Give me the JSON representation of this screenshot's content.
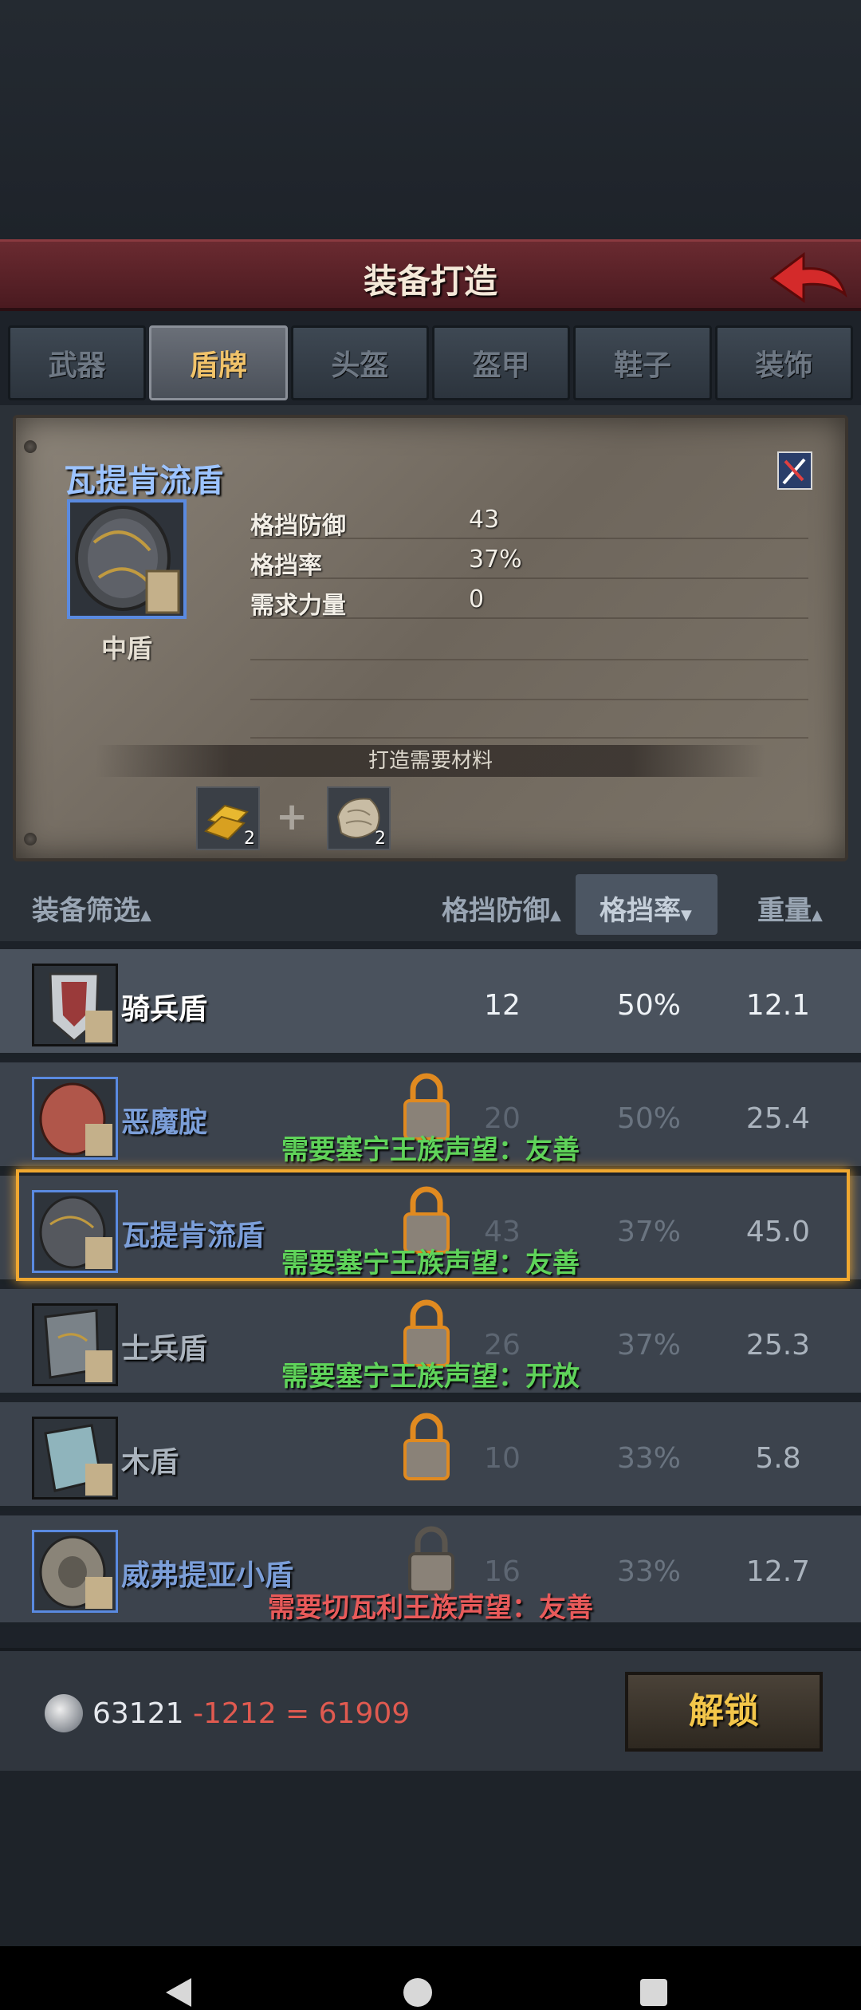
{
  "header": {
    "title": "装备打造"
  },
  "tabs": [
    {
      "label": "武器",
      "active": false
    },
    {
      "label": "盾牌",
      "active": true
    },
    {
      "label": "头盔",
      "active": false
    },
    {
      "label": "盔甲",
      "active": false
    },
    {
      "label": "鞋子",
      "active": false
    },
    {
      "label": "装饰",
      "active": false
    }
  ],
  "detail": {
    "name": "瓦提肯流盾",
    "type": "中盾",
    "stats": [
      {
        "label": "格挡防御",
        "value": "43"
      },
      {
        "label": "格挡率",
        "value": "37%"
      },
      {
        "label": "需求力量",
        "value": "0"
      }
    ],
    "materials_label": "打造需要材料",
    "materials": [
      {
        "icon": "gold-ingot-icon",
        "count": "2"
      },
      {
        "icon": "leather-hide-icon",
        "count": "2"
      }
    ]
  },
  "list_header": {
    "filter": "装备筛选",
    "defense": "格挡防御",
    "rate": "格挡率",
    "weight": "重量"
  },
  "items": [
    {
      "name": "骑兵盾",
      "defense": "12",
      "rate": "50%",
      "weight": "12.1",
      "locked": false,
      "requirement": ""
    },
    {
      "name": "恶魔腚",
      "defense": "20",
      "rate": "50%",
      "weight": "25.4",
      "locked": true,
      "requirement": "需要塞宁王族声望：友善"
    },
    {
      "name": "瓦提肯流盾",
      "defense": "43",
      "rate": "37%",
      "weight": "45.0",
      "locked": true,
      "requirement": "需要塞宁王族声望：友善"
    },
    {
      "name": "士兵盾",
      "defense": "26",
      "rate": "37%",
      "weight": "25.3",
      "locked": true,
      "requirement": "需要塞宁王族声望：开放"
    },
    {
      "name": "木盾",
      "defense": "10",
      "rate": "33%",
      "weight": "5.8",
      "locked": true,
      "requirement": ""
    },
    {
      "name": "威弗提亚小盾",
      "defense": "16",
      "rate": "33%",
      "weight": "12.7",
      "locked": true,
      "requirement": "需要切瓦利王族声望：友善"
    }
  ],
  "footer": {
    "balance": "63121",
    "cost": "-1212 = 61909",
    "unlock_label": "解锁"
  },
  "colors": {
    "req_green": "#5fd35a",
    "req_red": "#e85a5a",
    "selection": "#f0a830",
    "accent_gold": "#f1c36a"
  }
}
